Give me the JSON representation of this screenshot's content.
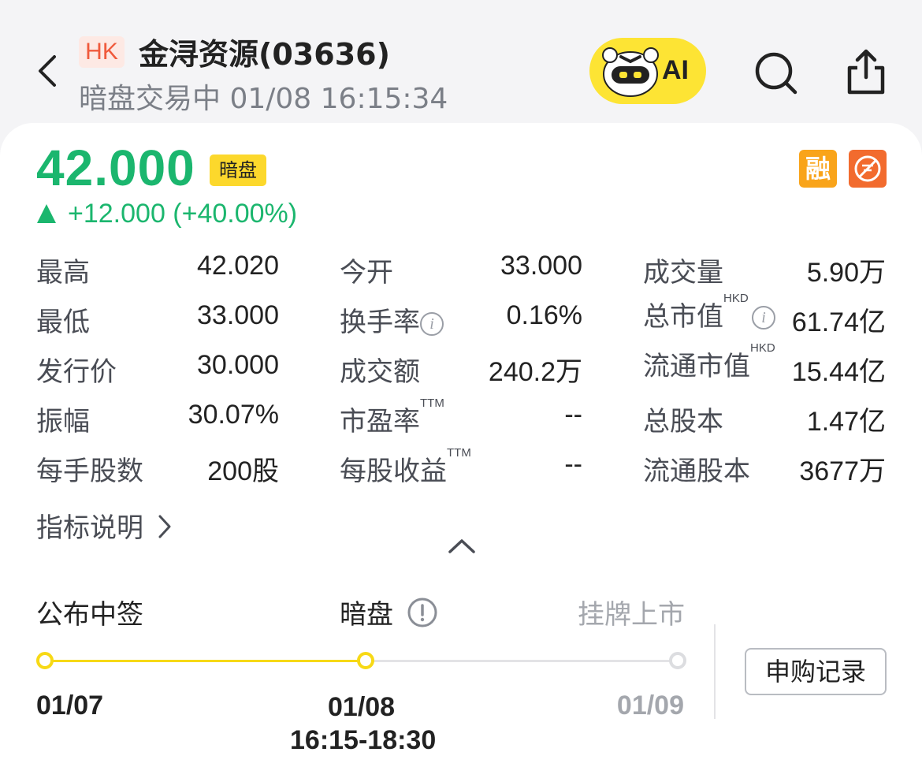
{
  "header": {
    "market": "HK",
    "title": "金浔资源(03636)",
    "status": "暗盘交易中 01/08 16:15:34",
    "ai_label": "AI"
  },
  "quote": {
    "price": "42.000",
    "price_tag": "暗盘",
    "change": "+12.000 (+40.00%)",
    "margin_icon_text": "融",
    "up_color": "#1bb66e"
  },
  "stats": {
    "col1": [
      {
        "label": "最高",
        "value": "42.020"
      },
      {
        "label": "最低",
        "value": "33.000"
      },
      {
        "label": "发行价",
        "value": "30.000"
      },
      {
        "label": "振幅",
        "value": "30.07%"
      },
      {
        "label": "每手股数",
        "value": "200股"
      }
    ],
    "col2": [
      {
        "label": "今开",
        "value": "33.000"
      },
      {
        "label": "换手率",
        "value": "0.16%"
      },
      {
        "label": "成交额",
        "value": "240.2万"
      },
      {
        "label": "市盈率",
        "sup": "TTM",
        "value": "--"
      },
      {
        "label": "每股收益",
        "sup": "TTM",
        "value": "--"
      }
    ],
    "col3": [
      {
        "label": "成交量",
        "value": "5.90万"
      },
      {
        "label": "总市值",
        "sup": "HKD",
        "value": "61.74亿"
      },
      {
        "label": "流通市值",
        "sup": "HKD",
        "value": "15.44亿"
      },
      {
        "label": "总股本",
        "value": "1.47亿"
      },
      {
        "label": "流通股本",
        "value": "3677万"
      }
    ]
  },
  "indicator_link": "指标说明",
  "timeline": {
    "steps": [
      {
        "label": "公布中签",
        "date": "01/07",
        "time": ""
      },
      {
        "label": "暗盘",
        "date": "01/08",
        "time": "16:15-18:30"
      },
      {
        "label": "挂牌上市",
        "date": "01/09",
        "time": ""
      }
    ],
    "active_color": "#f7d916"
  },
  "record_button": "申购记录"
}
